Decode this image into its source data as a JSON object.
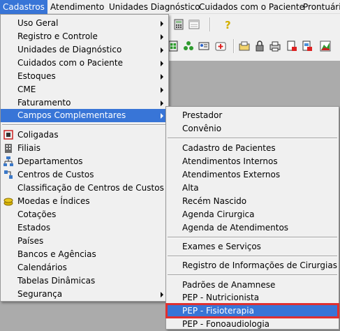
{
  "menubar": {
    "items": [
      "Cadastros",
      "Atendimento",
      "Unidades Diagnóstico",
      "Cuidados com o Paciente",
      "Prontuário"
    ]
  },
  "cadastros_menu": {
    "items": [
      "Uso Geral",
      "Registro e Controle",
      "Unidades de Diagnóstico",
      "Cuidados com o Paciente",
      "Estoques",
      "CME",
      "Faturamento",
      "Campos Complementares",
      "Coligadas",
      "Filiais",
      "Departamentos",
      "Centros de Custos",
      "Classificação de Centros de Custos",
      "Moedas e Índices",
      "Cotações",
      "Estados",
      "Países",
      "Bancos e Agências",
      "Calendários",
      "Tabelas Dinâmicas",
      "Segurança"
    ]
  },
  "campos_submenu": {
    "items": [
      "Prestador",
      "Convênio",
      "Cadastro de Pacientes",
      "Atendimentos Internos",
      "Atendimentos Externos",
      "Alta",
      "Recém Nascido",
      "Agenda Cirurgica",
      "Agenda de Atendimentos",
      "Exames e Serviços",
      "Registro de Informações de Cirurgias",
      "Padrões de Anamnese",
      "PEP - Nutricionista",
      "PEP - Fisioterapia",
      "PEP - Fonoaudiologia"
    ],
    "selected": "PEP - Fisioterapia"
  },
  "colors": {
    "highlight": "#3875d7",
    "selection_outline": "#e03030",
    "menu_bg": "#f0f0f0",
    "workspace_bg": "#ababab"
  }
}
